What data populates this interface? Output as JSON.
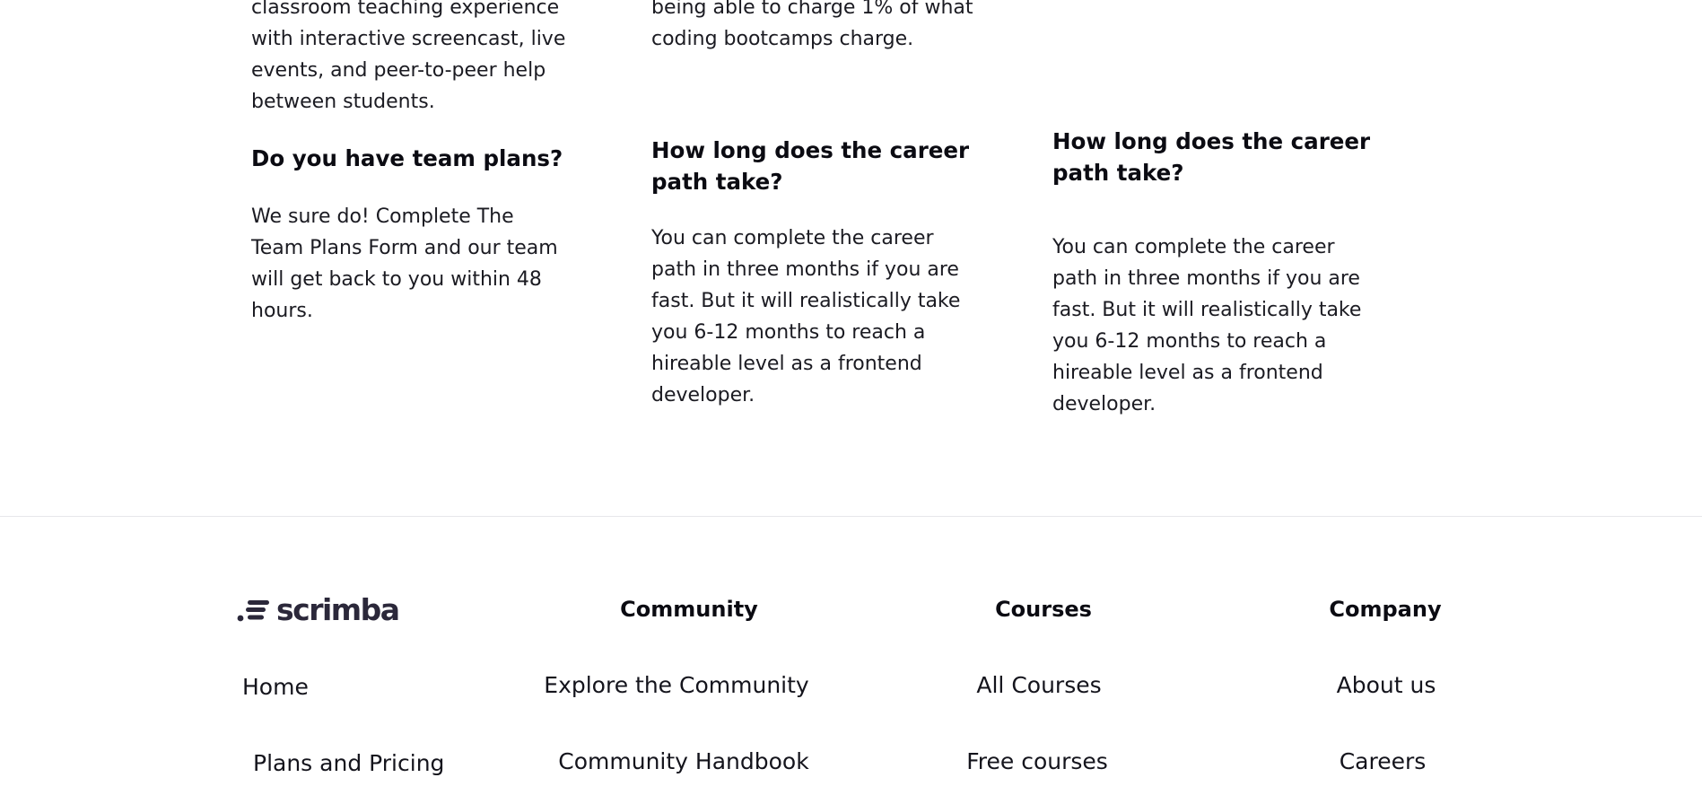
{
  "faq": {
    "col1": {
      "partial_text": "classroom teaching experience with interactive screencast, live events, and peer-to-peer help between students.",
      "question": "Do you have team plans?",
      "answer": "We sure do! Complete The Team Plans Form and our team will get back to you within 48 hours."
    },
    "col2": {
      "partial_text": "being able to charge 1% of what coding bootcamps charge.",
      "question": "How long does the career path take?",
      "answer": "You can complete the career path in three months if you are fast. But it will realistically take you 6-12 months to reach a hireable level as a frontend developer."
    },
    "col3": {
      "question": "How long does the career path take?",
      "answer": "You can complete the career path in three months if you are fast. But it will realistically take you 6-12 months to reach a hireable level as a frontend developer."
    }
  },
  "footer": {
    "logo_text": "scrimba",
    "logo_color": "#2b283a",
    "links_col1": [
      "Home",
      "Plans and Pricing"
    ],
    "community": {
      "title": "Community",
      "links": [
        "Explore the Community",
        "Community Handbook"
      ]
    },
    "courses": {
      "title": "Courses",
      "links": [
        "All Courses",
        "Free courses"
      ]
    },
    "company": {
      "title": "Company",
      "links": [
        "About us",
        "Careers"
      ]
    }
  }
}
